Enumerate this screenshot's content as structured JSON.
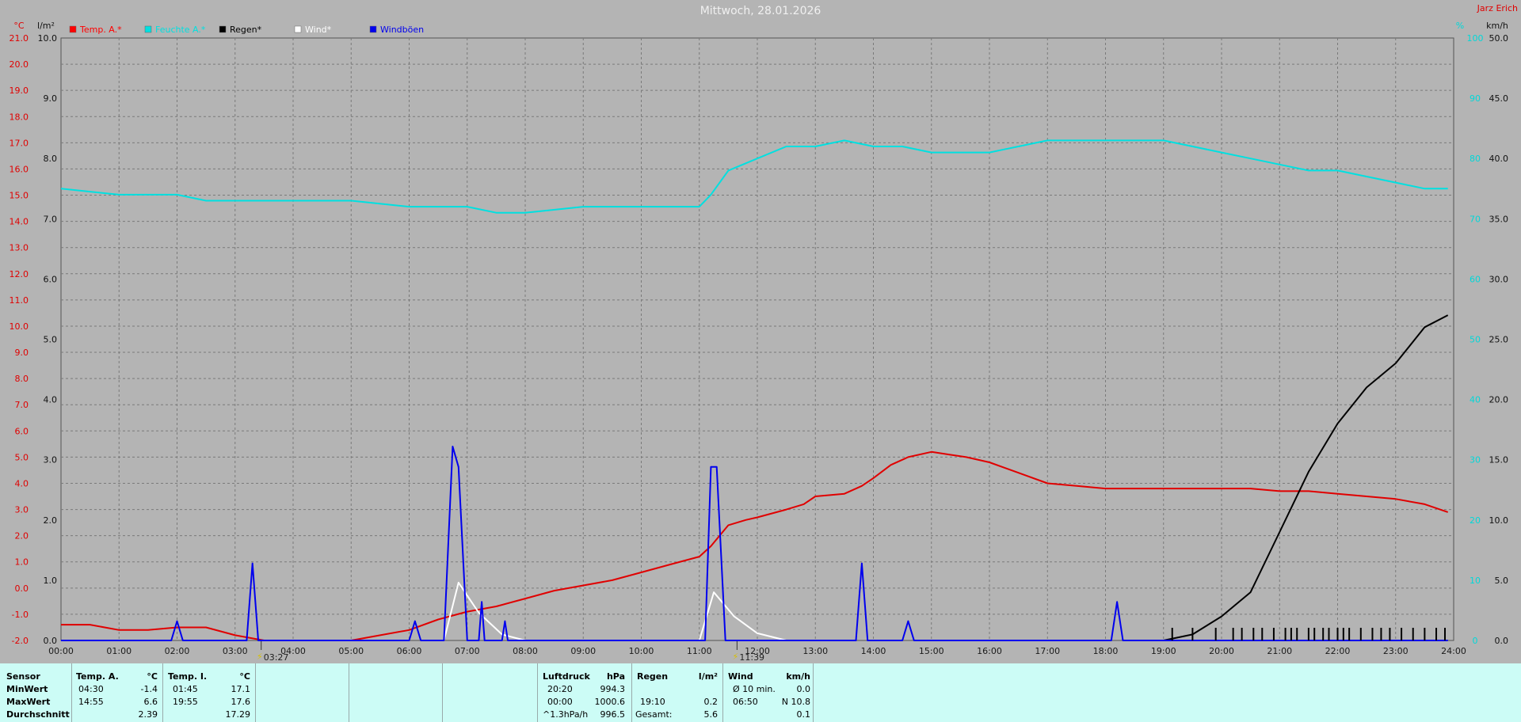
{
  "title": "Mittwoch, 28.01.2026",
  "author": "Jarz Erich",
  "axis_units": {
    "temp": "°C",
    "rain": "l/m²",
    "hum": "%",
    "wind": "km/h"
  },
  "colors": {
    "temp_outside": "#e00000",
    "humidity": "#00e0e0",
    "rain": "#000000",
    "wind": "#ffffff",
    "gusts": "#0000e0"
  },
  "legend": [
    {
      "label": "Temp. A.*",
      "color": "#ff0000"
    },
    {
      "label": "Feuchte A.*",
      "color": "#00e0e0"
    },
    {
      "label": "Regen*",
      "color": "#000000"
    },
    {
      "label": "Wind*",
      "color": "#ffffff"
    },
    {
      "label": "Windböen",
      "color": "#0000ee"
    }
  ],
  "markers": [
    {
      "time": 3.45,
      "label": "03:27"
    },
    {
      "time": 11.65,
      "label": "11:39"
    }
  ],
  "chart_data": {
    "type": "line",
    "x_unit": "hour",
    "xlim": [
      0,
      24
    ],
    "x_ticks": [
      "00:00",
      "01:00",
      "02:00",
      "03:00",
      "04:00",
      "05:00",
      "06:00",
      "07:00",
      "08:00",
      "09:00",
      "10:00",
      "11:00",
      "12:00",
      "13:00",
      "14:00",
      "15:00",
      "16:00",
      "17:00",
      "18:00",
      "19:00",
      "20:00",
      "21:00",
      "22:00",
      "23:00",
      "24:00"
    ],
    "y_axes": {
      "temp": {
        "range": [
          -2.0,
          21.0
        ],
        "ticks": [
          "-2.0",
          "-1.0",
          "0.0",
          "1.0",
          "2.0",
          "3.0",
          "4.0",
          "5.0",
          "6.0",
          "7.0",
          "8.0",
          "9.0",
          "10.0",
          "11.0",
          "12.0",
          "13.0",
          "14.0",
          "15.0",
          "16.0",
          "17.0",
          "18.0",
          "19.0",
          "20.0",
          "21.0"
        ]
      },
      "rain": {
        "range": [
          0.0,
          10.0
        ],
        "ticks": [
          "0.0",
          "1.0",
          "2.0",
          "3.0",
          "4.0",
          "5.0",
          "6.0",
          "7.0",
          "8.0",
          "9.0",
          "10.0"
        ]
      },
      "hum": {
        "range": [
          0,
          100
        ],
        "ticks": [
          "0",
          "10",
          "20",
          "30",
          "40",
          "50",
          "60",
          "70",
          "80",
          "90",
          "100"
        ]
      },
      "wind": {
        "range": [
          0.0,
          50.0
        ],
        "ticks": [
          "0.0",
          "5.0",
          "10.0",
          "15.0",
          "20.0",
          "25.0",
          "30.0",
          "35.0",
          "40.0",
          "45.0",
          "50.0"
        ]
      }
    },
    "grid": true,
    "series": [
      {
        "name": "Temp. A.*",
        "axis": "temp",
        "color": "#e00000",
        "points": [
          [
            0,
            -1.4
          ],
          [
            0.5,
            -1.4
          ],
          [
            1,
            -1.6
          ],
          [
            1.5,
            -1.6
          ],
          [
            2,
            -1.5
          ],
          [
            2.5,
            -1.5
          ],
          [
            3,
            -1.8
          ],
          [
            3.5,
            -2.0
          ],
          [
            4,
            -2.0
          ],
          [
            4.5,
            -2.0
          ],
          [
            5,
            -2.0
          ],
          [
            5.5,
            -1.8
          ],
          [
            6,
            -1.6
          ],
          [
            6.5,
            -1.2
          ],
          [
            7,
            -0.9
          ],
          [
            7.5,
            -0.7
          ],
          [
            8,
            -0.4
          ],
          [
            8.5,
            -0.1
          ],
          [
            9,
            0.1
          ],
          [
            9.5,
            0.3
          ],
          [
            10,
            0.6
          ],
          [
            10.5,
            0.9
          ],
          [
            11,
            1.2
          ],
          [
            11.2,
            1.6
          ],
          [
            11.5,
            2.4
          ],
          [
            11.8,
            2.6
          ],
          [
            12,
            2.7
          ],
          [
            12.5,
            3.0
          ],
          [
            12.8,
            3.2
          ],
          [
            13,
            3.5
          ],
          [
            13.5,
            3.6
          ],
          [
            13.8,
            3.9
          ],
          [
            14,
            4.2
          ],
          [
            14.3,
            4.7
          ],
          [
            14.6,
            5.0
          ],
          [
            15,
            5.2
          ],
          [
            15.3,
            5.1
          ],
          [
            15.6,
            5.0
          ],
          [
            16,
            4.8
          ],
          [
            16.5,
            4.4
          ],
          [
            17,
            4.0
          ],
          [
            17.5,
            3.9
          ],
          [
            18,
            3.8
          ],
          [
            18.5,
            3.8
          ],
          [
            19,
            3.8
          ],
          [
            19.5,
            3.8
          ],
          [
            20,
            3.8
          ],
          [
            20.5,
            3.8
          ],
          [
            21,
            3.7
          ],
          [
            21.5,
            3.7
          ],
          [
            22,
            3.6
          ],
          [
            22.5,
            3.5
          ],
          [
            23,
            3.4
          ],
          [
            23.5,
            3.2
          ],
          [
            23.9,
            2.9
          ]
        ]
      },
      {
        "name": "Feuchte A.*",
        "axis": "hum",
        "color": "#00e0e0",
        "points": [
          [
            0,
            75
          ],
          [
            1,
            74
          ],
          [
            2,
            74
          ],
          [
            2.5,
            73
          ],
          [
            3,
            73
          ],
          [
            4,
            73
          ],
          [
            5,
            73
          ],
          [
            6,
            72
          ],
          [
            7,
            72
          ],
          [
            7.5,
            71
          ],
          [
            8,
            71
          ],
          [
            9,
            72
          ],
          [
            10,
            72
          ],
          [
            11,
            72
          ],
          [
            11.2,
            74
          ],
          [
            11.5,
            78
          ],
          [
            12,
            80
          ],
          [
            12.5,
            82
          ],
          [
            13,
            82
          ],
          [
            13.5,
            83
          ],
          [
            14,
            82
          ],
          [
            14.5,
            82
          ],
          [
            15,
            81
          ],
          [
            15.5,
            81
          ],
          [
            16,
            81
          ],
          [
            16.5,
            82
          ],
          [
            17,
            83
          ],
          [
            18,
            83
          ],
          [
            19,
            83
          ],
          [
            20,
            81
          ],
          [
            20.5,
            80
          ],
          [
            21,
            79
          ],
          [
            21.5,
            78
          ],
          [
            22,
            78
          ],
          [
            22.5,
            77
          ],
          [
            23,
            76
          ],
          [
            23.5,
            75
          ],
          [
            23.9,
            75
          ]
        ]
      },
      {
        "name": "Regen*",
        "axis": "rain",
        "color": "#000000",
        "points": [
          [
            19,
            0
          ],
          [
            19.5,
            0.1
          ],
          [
            20,
            0.4
          ],
          [
            20.5,
            0.8
          ],
          [
            21,
            1.8
          ],
          [
            21.5,
            2.8
          ],
          [
            22,
            3.6
          ],
          [
            22.5,
            4.2
          ],
          [
            23,
            4.6
          ],
          [
            23.5,
            5.2
          ],
          [
            23.9,
            5.4
          ]
        ]
      },
      {
        "name": "Wind*",
        "axis": "wind",
        "color": "#ffffff",
        "points": [
          [
            6.6,
            0
          ],
          [
            6.85,
            4.8
          ],
          [
            7.2,
            2.3
          ],
          [
            7.6,
            0.5
          ],
          [
            8,
            0
          ],
          [
            11,
            0
          ],
          [
            11.25,
            4.0
          ],
          [
            11.6,
            2.0
          ],
          [
            12,
            0.6
          ],
          [
            12.5,
            0
          ]
        ]
      },
      {
        "name": "Windböen",
        "axis": "wind",
        "color": "#0000ee",
        "points": [
          [
            0,
            0
          ],
          [
            1.9,
            0
          ],
          [
            2,
            1.6
          ],
          [
            2.1,
            0
          ],
          [
            3.2,
            0
          ],
          [
            3.3,
            6.4
          ],
          [
            3.4,
            0
          ],
          [
            6,
            0
          ],
          [
            6.1,
            1.6
          ],
          [
            6.2,
            0
          ],
          [
            6.6,
            0
          ],
          [
            6.75,
            16.1
          ],
          [
            6.85,
            14.4
          ],
          [
            7,
            0
          ],
          [
            7.2,
            0
          ],
          [
            7.25,
            3.2
          ],
          [
            7.3,
            0
          ],
          [
            7.6,
            0
          ],
          [
            7.65,
            1.6
          ],
          [
            7.7,
            0
          ],
          [
            11.1,
            0
          ],
          [
            11.2,
            14.4
          ],
          [
            11.3,
            14.4
          ],
          [
            11.45,
            0
          ],
          [
            13.7,
            0
          ],
          [
            13.8,
            6.4
          ],
          [
            13.9,
            0
          ],
          [
            14.5,
            0
          ],
          [
            14.6,
            1.6
          ],
          [
            14.7,
            0
          ],
          [
            18.1,
            0
          ],
          [
            18.2,
            3.2
          ],
          [
            18.3,
            0
          ],
          [
            23.9,
            0
          ]
        ]
      }
    ],
    "rain_ticks": [
      19.15,
      19.5,
      19.9,
      20.2,
      20.35,
      20.55,
      20.7,
      20.9,
      21.1,
      21.2,
      21.3,
      21.5,
      21.6,
      21.75,
      21.85,
      22.0,
      22.1,
      22.2,
      22.4,
      22.6,
      22.75,
      22.9,
      23.1,
      23.3,
      23.5,
      23.7,
      23.85
    ]
  },
  "stats": {
    "sensor_header": "Sensor",
    "row_labels": [
      "MinWert",
      "MaxWert",
      "Durchschnitt"
    ],
    "temp_a": {
      "title": "Temp. A.",
      "unit": "°C",
      "rows": [
        [
          "04:30",
          "-1.4"
        ],
        [
          "14:55",
          "6.6"
        ],
        [
          "",
          "2.39"
        ]
      ]
    },
    "temp_i": {
      "title": "Temp. I.",
      "unit": "°C",
      "rows": [
        [
          "01:45",
          "17.1"
        ],
        [
          "19:55",
          "17.6"
        ],
        [
          "",
          "17.29"
        ]
      ]
    },
    "luftdruck": {
      "title": "Luftdruck",
      "unit": "hPa",
      "rows": [
        [
          "20:20",
          "994.3"
        ],
        [
          "00:00",
          "1000.6"
        ],
        [
          "^1.3hPa/h",
          "996.5"
        ]
      ]
    },
    "regen": {
      "title": "Regen",
      "unit": "l/m²",
      "rows": [
        [
          "",
          ""
        ],
        [
          "19:10",
          "0.2"
        ],
        [
          "Gesamt:",
          "5.6"
        ]
      ]
    },
    "wind": {
      "title": "Wind",
      "unit": "km/h",
      "rows": [
        [
          "Ø 10 min.",
          "0.0"
        ],
        [
          "06:50",
          "N 10.8"
        ],
        [
          "",
          "0.1"
        ]
      ]
    }
  }
}
